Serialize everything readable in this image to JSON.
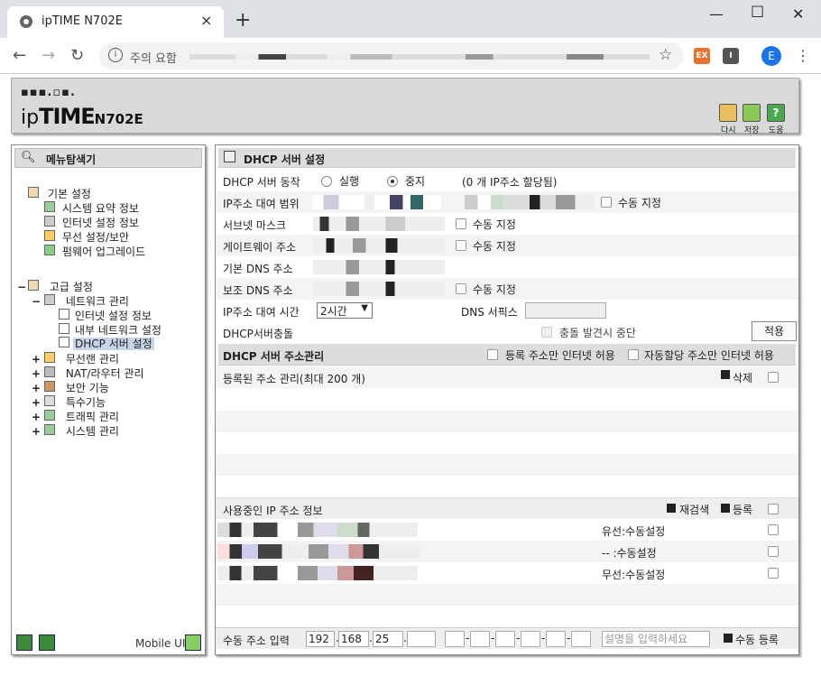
{
  "browser": {
    "tab_title": "ipTIME N702E",
    "tab_close": "×",
    "new_tab": "+",
    "min": "—",
    "max": "☐",
    "close": "✕",
    "back": "←",
    "forward": "→",
    "reload": "↻",
    "security": "주의 요함",
    "profile_initial": "E",
    "ext1": "EX",
    "ext2": "I"
  },
  "header": {
    "logo_top": "▪▪▪.▫▪.",
    "logo_ip": "ip",
    "logo_time": "TIME",
    "logo_model": "N702E",
    "btn_back": "다시",
    "btn_save": "저장",
    "btn_help": "도움"
  },
  "sidebar": {
    "title": "메뉴탐색기",
    "basic": {
      "label": "기본 설정",
      "items": [
        "시스템 요약 정보",
        "인터넷 설정 정보",
        "무선 설정/보안",
        "펌웨어 업그레이드"
      ]
    },
    "advanced": {
      "label": "고급 설정",
      "network": "네트워크 관리",
      "network_items": [
        "인터넷 설정 정보",
        "내부 네트워크 설정",
        "DHCP 서버 설정"
      ],
      "groups": [
        "무선랜 관리",
        "NAT/라우터 관리",
        "보안 기능",
        "특수기능",
        "트래픽 관리",
        "시스템 관리"
      ]
    },
    "minus": "−",
    "plus": "+",
    "mobile": "Mobile UI"
  },
  "main": {
    "title": "DHCP 서버 설정",
    "rows": {
      "server_action": "DHCP 서버 동작",
      "run": "실행",
      "stop": "중지",
      "alloc_note": "(0 개 IP주소 할당됨)",
      "range": "IP주소 대여 범위",
      "subnet": "서브넷 마스크",
      "gateway": "게이트웨이 주소",
      "dns1": "기본 DNS 주소",
      "dns2": "보조 DNS 주소",
      "lease": "IP주소 대여 시간",
      "lease_value": "2시간",
      "dns_suffix": "DNS 서픽스",
      "conflict": "DHCP서버충돌",
      "conflict_stop": "충돌 발견시 중단",
      "manual": "수동 지정",
      "apply": "적용"
    },
    "addr_mgmt": {
      "title": "DHCP 서버 주소관리",
      "reg_only": "등록 주소만 인터넷 허용",
      "auto_only": "자동할당 주소만 인터넷 허용",
      "registered": "등록된 주소 관리(최대 200 개)",
      "delete": "삭제"
    },
    "in_use": {
      "title": "사용중인 IP 주소 정보",
      "rescan": "재검색",
      "register": "등록",
      "rows": [
        "유선:수동설정",
        "-- :수동설정",
        "무선:수동설정"
      ]
    },
    "manual_input": {
      "label": "수동 주소 입력",
      "ip1": "192",
      "ip2": "168",
      "ip3": "25",
      "placeholder": "설명을 입력하세요",
      "register": "수동 등록"
    }
  },
  "colors": {
    "chrome_bg": "#dee1e6",
    "panel_head": "#dddddd",
    "accent_green": "#3a8a3a",
    "highlight": "#c8d4e8"
  }
}
